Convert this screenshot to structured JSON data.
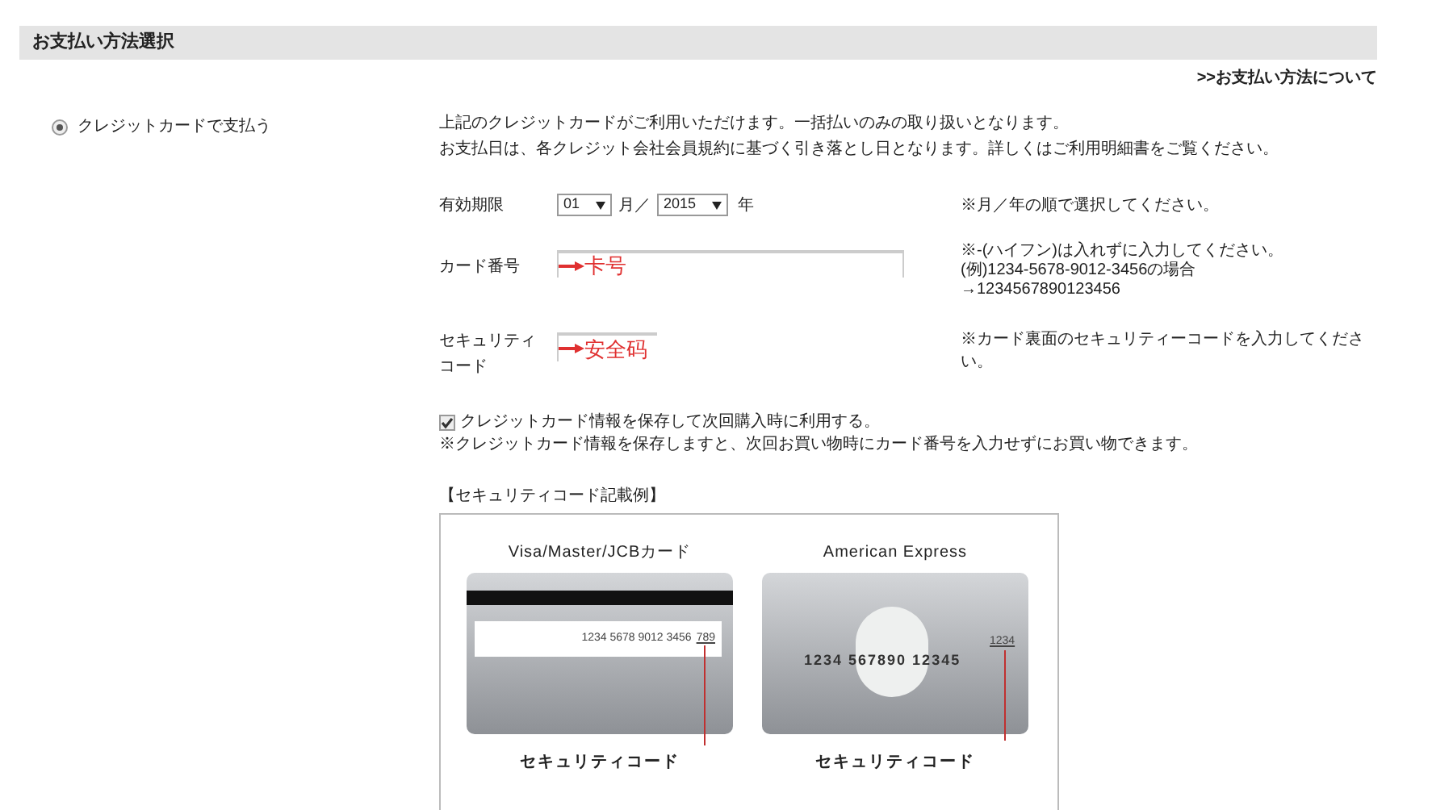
{
  "header": {
    "title": "お支払い方法選択"
  },
  "help_link": ">>お支払い方法について",
  "payment_options": [
    {
      "label": "クレジットカードで支払う",
      "selected": true
    }
  ],
  "notice": [
    "上記のクレジットカードがご利用いただけます。一括払いのみの取り扱いとなります。",
    "お支払日は、各クレジット会社会員規約に基づく引き落とし日となります。詳しくはご利用明細書をご覧ください。"
  ],
  "expiry": {
    "label": "有効期限",
    "month": "01",
    "month_unit": "月／",
    "year": "2015",
    "year_unit": "年",
    "hint": "※月／年の順で選択してください。"
  },
  "card_number": {
    "label": "カード番号",
    "annotation": "卡号",
    "hint": [
      "※-(ハイフン)は入れずに入力してください。",
      "(例)1234-5678-9012-3456の場合",
      "→1234567890123456"
    ]
  },
  "security_code": {
    "label": "セキュリティコード",
    "annotation": "安全码",
    "hint": "※カード裏面のセキュリティーコードを入力してください。"
  },
  "save_card": {
    "label": "クレジットカード情報を保存して次回購入時に利用する。",
    "checked": true,
    "note": "※クレジットカード情報を保存しますと、次回お買い物時にカード番号を入力せずにお買い物できます。"
  },
  "example": {
    "title": "【セキュリティコード記載例】",
    "cards": [
      {
        "kind": "back",
        "title": "Visa/Master/JCBカード",
        "number": "1234 5678 9012 3456",
        "code": "789",
        "code_label": "セキュリティコード"
      },
      {
        "kind": "front",
        "title": "American Express",
        "number": "1234 567890 12345",
        "code": "1234",
        "code_label": "セキュリティコード"
      }
    ]
  }
}
